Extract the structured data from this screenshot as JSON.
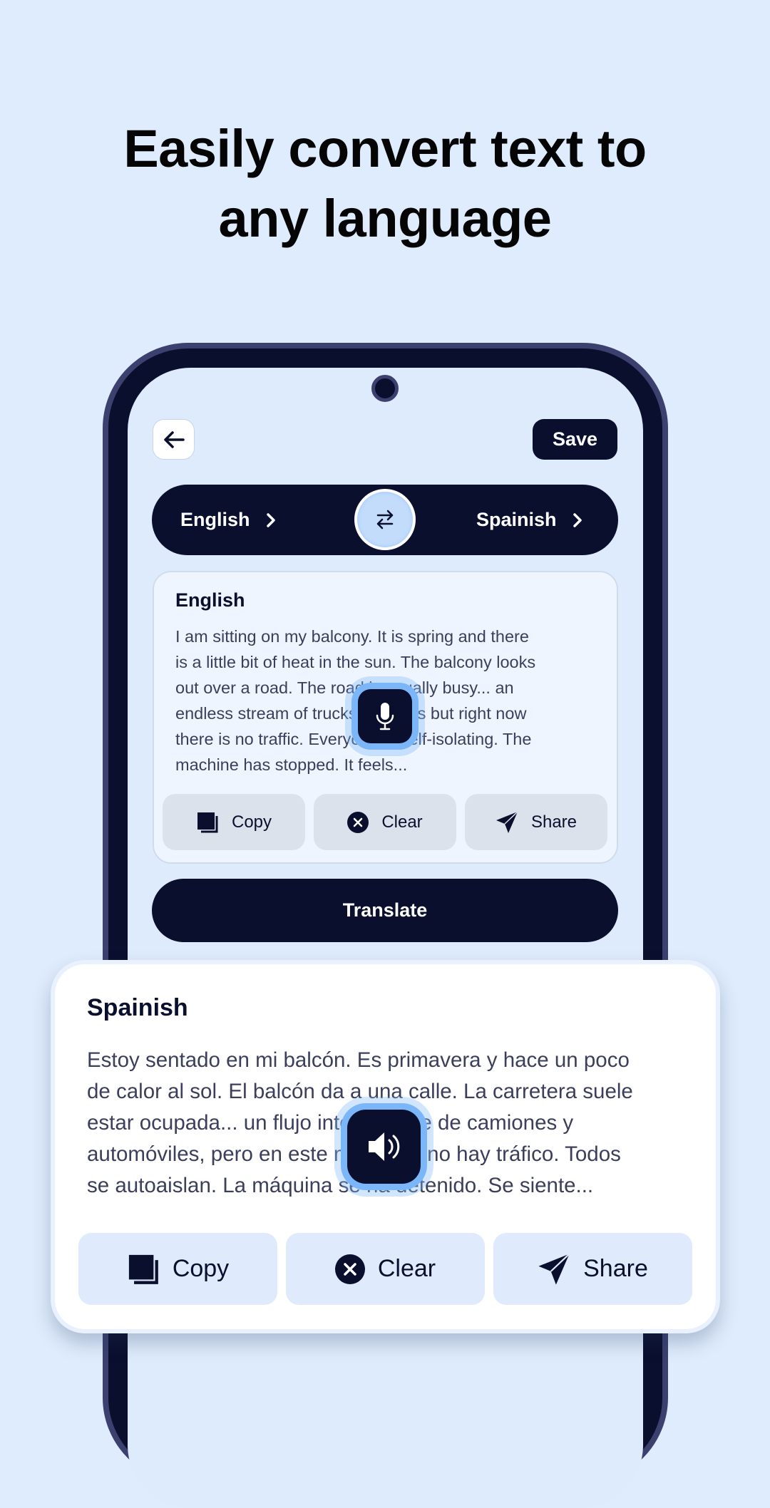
{
  "headline": {
    "lines": [
      "Easily convert text to",
      "any language"
    ]
  },
  "toolbar": {
    "back_icon": "arrow-left-icon",
    "save_label": "Save"
  },
  "language_bar": {
    "source": "English",
    "target": "Spainish",
    "swap_icon": "swap-arrows-icon"
  },
  "source_card": {
    "title": "English",
    "lines": [
      "I am sitting on my balcony. It is spring and there",
      "is a little bit of heat in the sun. The balcony looks",
      "out over a road. The road is usually busy... an",
      "endless stream of trucks and cars but right now",
      "there is no traffic. Everyone is self-isolating. The",
      "machine has stopped. It feels..."
    ],
    "mic_icon": "microphone-icon",
    "actions": [
      {
        "label": "Copy",
        "icon": "copy-icon"
      },
      {
        "label": "Clear",
        "icon": "clear-circle-icon"
      },
      {
        "label": "Share",
        "icon": "send-icon"
      }
    ]
  },
  "translate_label": "Translate",
  "output_card": {
    "title": "Spainish",
    "lines": [
      "Estoy sentado en mi balcón. Es primavera y hace un poco",
      "de calor al sol. El balcón da a una calle. La carretera suele",
      "estar ocupada... un flujo interminable de camiones y",
      "automóviles, pero en este momento no hay tráfico. Todos",
      "se autoaislan. La máquina se ha detenido. Se siente..."
    ],
    "speaker_icon": "speaker-icon",
    "actions": [
      {
        "label": "Copy",
        "icon": "copy-icon"
      },
      {
        "label": "Clear",
        "icon": "clear-circle-icon"
      },
      {
        "label": "Share",
        "icon": "send-icon"
      }
    ]
  },
  "colors": {
    "background": "#dfecfd",
    "primary": "#0b0f2e",
    "accent": "#7bb6f8"
  }
}
